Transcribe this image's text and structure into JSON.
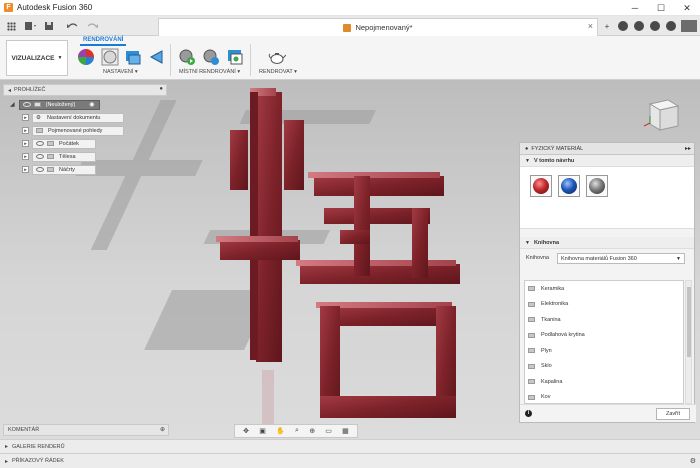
{
  "window": {
    "title": "Autodesk Fusion 360",
    "minimize": "─",
    "maximize": "☐",
    "close": "✕"
  },
  "tabs": {
    "document_title": "Nepojmenovaný*",
    "close_symbol": "×",
    "new_tab": "+"
  },
  "toolbar": {
    "workspace": "VIZUALIZACE",
    "workspace_arrow": "▼",
    "ribbon_tab": "RENDROVÁNÍ",
    "groups": {
      "setup": "NASTAVENÍ ▾",
      "local_render": "MÍSTNÍ RENDROVÁNÍ ▾",
      "render": "RENDROVAT ▾"
    }
  },
  "browser": {
    "header": "PROHLÍŽEČ",
    "collapse": "◂",
    "pin": "▸",
    "root": "(Neuložený)",
    "items": [
      {
        "label": "Nastavení dokumentu"
      },
      {
        "label": "Pojmenované pohledy"
      },
      {
        "label": "Počátek"
      },
      {
        "label": "Tělesa"
      },
      {
        "label": "Náčrty"
      }
    ]
  },
  "comments": {
    "header": "KOMENTÁŘ"
  },
  "material_panel": {
    "header": "FYZICKÝ MATERIÁL",
    "expand": "▸▸",
    "section_design": "V tomto návrhu",
    "section_library": "Knihovna",
    "library_label": "Knihovna",
    "library_select": "Knihovna materiálů Fusion 360",
    "categories": [
      "Keramika",
      "Elektronika",
      "Tkanina",
      "Podlahová krytina",
      "Plyn",
      "Sklo",
      "Kapalina",
      "Kov"
    ],
    "info": "i",
    "close_button": "Zavřít",
    "swatch_colors": [
      "#c0282b",
      "#1c57b8",
      "#7a7a7a"
    ]
  },
  "bottom": {
    "gallery": "GALERIE RENDERŮ",
    "command_line": "PŘÍKAZOVÝ ŘÁDEK"
  },
  "colors": {
    "accent": "#1a7bd4",
    "model": "#8c2c33",
    "model_highlight": "#c86a72"
  }
}
